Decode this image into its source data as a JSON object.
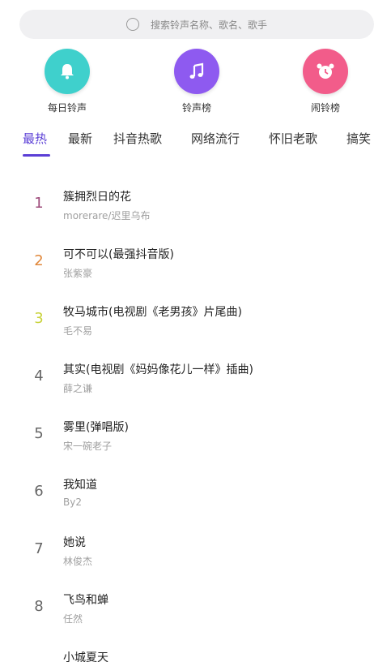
{
  "search": {
    "placeholder": "搜索铃声名称、歌名、歌手"
  },
  "shortcuts": [
    {
      "label": "每日铃声",
      "icon": "bell-icon",
      "color": "#3fd0cc"
    },
    {
      "label": "铃声榜",
      "icon": "music-note-icon",
      "color": "#8e5af0"
    },
    {
      "label": "闹铃榜",
      "icon": "alarm-clock-icon",
      "color": "#f25c8a"
    }
  ],
  "tabs": [
    {
      "label": "最热",
      "active": true
    },
    {
      "label": "最新"
    },
    {
      "label": "抖音热歌"
    },
    {
      "label": "网络流行"
    },
    {
      "label": "怀旧老歌"
    },
    {
      "label": "搞笑"
    }
  ],
  "songs": [
    {
      "rank": "1",
      "title": "簇拥烈日的花",
      "artist": "morerare/迟里乌布",
      "rank_color": "#9e4b7a"
    },
    {
      "rank": "2",
      "title": "可不可以(最强抖音版)",
      "artist": "张紫豪",
      "rank_color": "#e0873a"
    },
    {
      "rank": "3",
      "title": "牧马城市(电视剧《老男孩》片尾曲)",
      "artist": "毛不易",
      "rank_color": "#c8d23a"
    },
    {
      "rank": "4",
      "title": "其实(电视剧《妈妈像花儿一样》插曲)",
      "artist": "薛之谦"
    },
    {
      "rank": "5",
      "title": "雾里(弹唱版)",
      "artist": "宋一碗老子"
    },
    {
      "rank": "6",
      "title": "我知道",
      "artist": "By2"
    },
    {
      "rank": "7",
      "title": "她说",
      "artist": "林俊杰"
    },
    {
      "rank": "8",
      "title": "飞鸟和蝉",
      "artist": "任然"
    },
    {
      "rank": "",
      "title": "小城夏天",
      "artist": ""
    }
  ],
  "colors": {
    "accent": "#5b3fd6"
  }
}
